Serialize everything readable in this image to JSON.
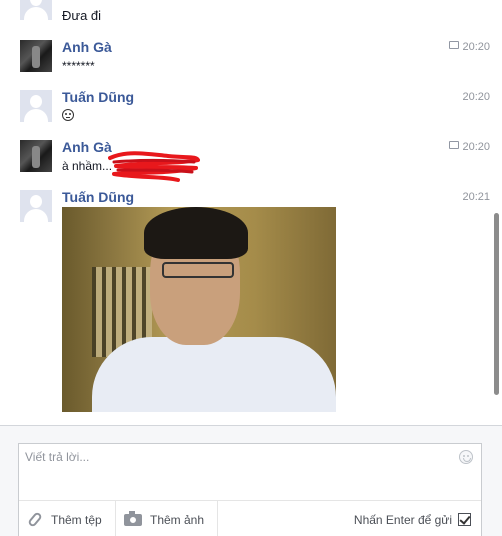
{
  "messages": [
    {
      "author": "",
      "text": "Đưa đi",
      "time": ""
    },
    {
      "author": "Anh Gà",
      "text": "*******",
      "time": "20:20"
    },
    {
      "author": "Tuấn Dũng",
      "text": "",
      "time": "20:20"
    },
    {
      "author": "Anh Gà",
      "text": "à nhầm...",
      "time": "20:20"
    },
    {
      "author": "Tuấn Dũng",
      "text": "",
      "time": "20:21"
    }
  ],
  "composer": {
    "placeholder": "Viết trả lời...",
    "attach_label": "Thêm tệp",
    "photo_label": "Thêm ảnh",
    "enter_send_label": "Nhấn Enter để gửi",
    "enter_send_checked": true
  },
  "icons": {
    "web": "web-sent-icon",
    "emoji": "smiley-icon",
    "attach": "paperclip-icon",
    "photo": "camera-icon",
    "composer_emoji": "emoji-picker-icon",
    "check": "checkbox-icon"
  },
  "colors": {
    "author": "#3b5998",
    "time": "#90949c",
    "scribble": "#e8181c"
  },
  "scroll": {
    "position": 0.53
  }
}
